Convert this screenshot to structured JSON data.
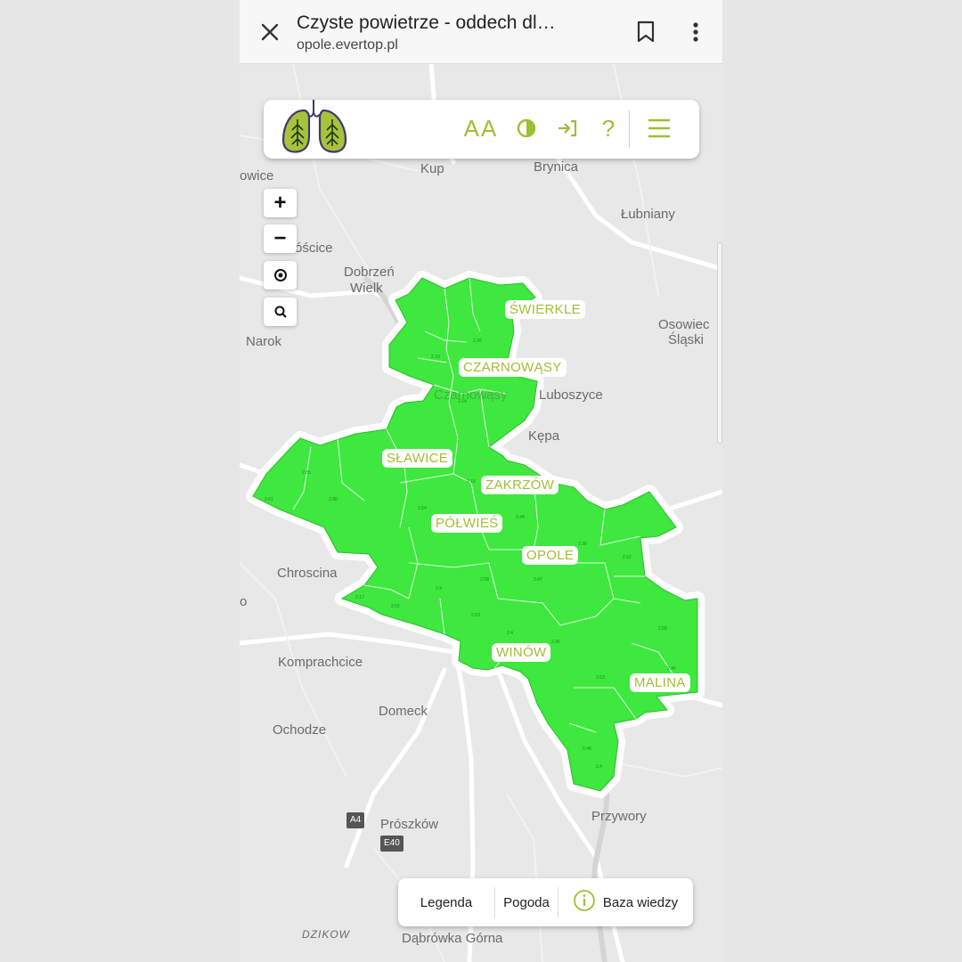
{
  "browser": {
    "title": "Czyste powietrze - oddech dl…",
    "url": "opole.evertop.pl",
    "close_icon": "close-icon",
    "bookmark_icon": "bookmark-icon",
    "menu_icon": "more-vertical-icon"
  },
  "appbar": {
    "logo": "lungs-tree-logo",
    "font_size_label": "AA",
    "icons": [
      "font-size-icon",
      "contrast-icon",
      "login-icon",
      "help-icon",
      "hamburger-menu-icon"
    ],
    "help_label": "?"
  },
  "map_controls": {
    "zoom_in": "+",
    "zoom_out": "−",
    "locate_icon": "locate-icon",
    "search_icon": "search-icon"
  },
  "districts": [
    "ŚWIERKLE",
    "CZARNOWĄSY",
    "SŁAWICE",
    "ZAKRZÓW",
    "PÓŁWIEŚ",
    "OPOLE",
    "WINÓW",
    "MALINA"
  ],
  "places": [
    "owice",
    "Kup",
    "Brynica",
    "Łubniany",
    "óścice",
    "Dobrzeń",
    "Wielk",
    "Osowiec",
    "Śląski",
    "Narok",
    "Czarnowąsy",
    "Luboszyce",
    "Kępa",
    "Chroscina",
    "o",
    "Komprachcice",
    "Domeck",
    "Ochodze",
    "Przywory",
    "Prószków",
    "A4",
    "E40",
    "DZIKOW",
    "Dąbrówka Górna"
  ],
  "bottom": {
    "legend_label": "Legenda",
    "weather_label": "Pogoda",
    "knowledge_label": "Baza wiedzy",
    "info_icon": "info-icon"
  },
  "colors": {
    "accent": "#9dbf33",
    "district_fill": "#3ee83e",
    "map_bg": "#e8e8e8"
  }
}
